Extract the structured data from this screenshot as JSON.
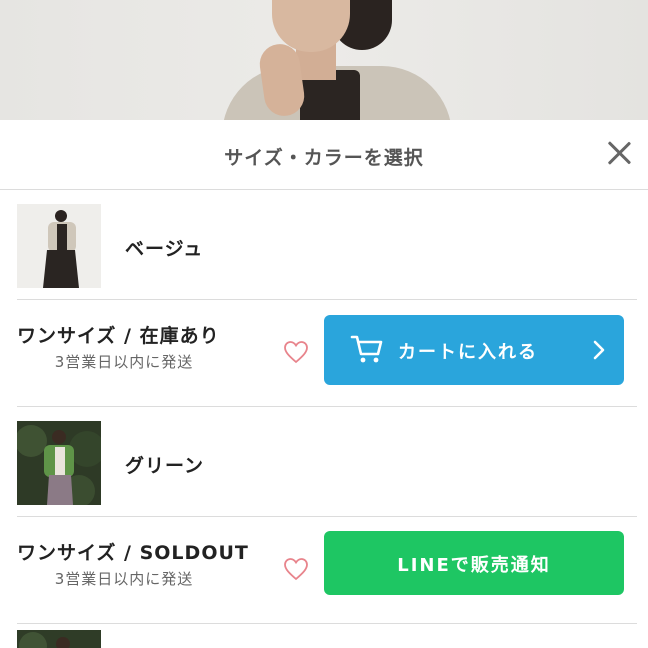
{
  "header": {
    "title": "サイズ・カラーを選択"
  },
  "variants": [
    {
      "color": "ベージュ",
      "size_label": "ワンサイズ / 在庫あり",
      "shipping": "3営業日以内に発送",
      "button_label": "カートに入れる",
      "button_color": "#2aa5dc"
    },
    {
      "color": "グリーン",
      "size_label": "ワンサイズ / SOLDOUT",
      "shipping": "3営業日以内に発送",
      "button_label": "LINEで販売通知",
      "button_color": "#1ec663"
    }
  ],
  "icons": {
    "close": "close-icon",
    "heart": "heart-icon",
    "cart": "cart-icon",
    "chevron": "chevron-right-icon"
  },
  "colors": {
    "accent_blue": "#2aa5dc",
    "line_green": "#1ec663",
    "heart_pink": "#e8848c"
  }
}
